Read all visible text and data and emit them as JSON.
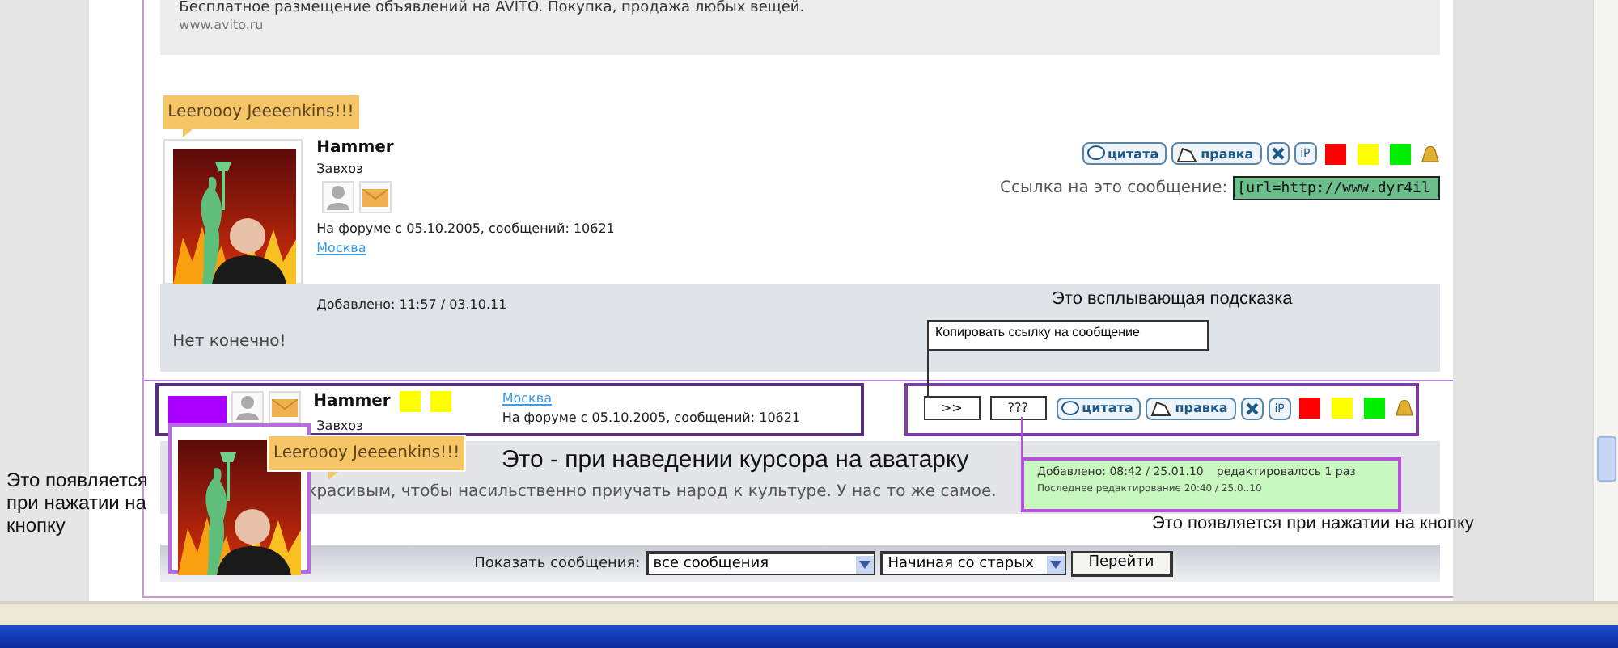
{
  "ad": {
    "text": "Бесплатное размещение объявлений на AVITO. Покупка, продажа любых вещей.",
    "url": "www.avito.ru"
  },
  "posts": [
    {
      "kind": "full",
      "status": "Leeroooy Jeeeenkins!!!",
      "name": "Hammer",
      "rank": "Завхоз",
      "since": "На форуме с 05.10.2005, сообщений: 10621",
      "city": "Москва",
      "link_label": "Ссылка на это сообщение:",
      "link_value": "[url=http://www.dyr4il",
      "added": "Добавлено: 11:57 / 03.10.11",
      "body": "Нет конечно!",
      "actions": [
        {
          "kind": "quote",
          "label": "цитата"
        },
        {
          "kind": "edit",
          "label": "правка"
        },
        {
          "kind": "delete"
        },
        {
          "kind": "ip",
          "label": "iP"
        },
        {
          "kind": "flag",
          "color": "#ff0000"
        },
        {
          "kind": "flag",
          "color": "#ffff00"
        },
        {
          "kind": "flag",
          "color": "#00ee00"
        },
        {
          "kind": "bell"
        }
      ]
    },
    {
      "kind": "compact",
      "name": "Hammer",
      "rank": "Завхоз",
      "since": "На форуме с 05.10.2005, сообщений: 10621",
      "city": "Москва",
      "badges": [
        {
          "color": "#ffff00"
        },
        {
          "color": "#ffff00"
        }
      ],
      "tools": [
        {
          "label": ">>"
        },
        {
          "label": "???"
        }
      ],
      "body": "красивым, чтобы насильственно приучать народ к культуре. У нас то же самое.",
      "actions": [
        {
          "kind": "quote",
          "label": "цитата"
        },
        {
          "kind": "edit",
          "label": "правка"
        },
        {
          "kind": "delete"
        },
        {
          "kind": "ip",
          "label": "iP"
        },
        {
          "kind": "flag",
          "color": "#ff0000"
        },
        {
          "kind": "flag",
          "color": "#ffff00"
        },
        {
          "kind": "flag",
          "color": "#00ee00"
        },
        {
          "kind": "bell"
        }
      ]
    }
  ],
  "footer": {
    "label": "Показать сообщения:",
    "filter": "все сообщения",
    "order": "Начиная со старых",
    "go": "Перейти"
  },
  "overlays": {
    "tooltip_note": "Это всплывающая подсказка",
    "tooltip": "Копировать ссылку на сообщение",
    "left_note": "Это появляется при нажатии на кнопку",
    "popup_status": "Leeroooy Jeeeenkins!!!",
    "hover_note": "Это - при наведении курсора на аватарку",
    "info_added": "Добавлено: 08:42 / 25.01.10",
    "info_edited": "редактировалось 1 раз",
    "info_last": "Последнее редактирование 20:40 / 25.0..10",
    "info_note": "Это появляется при нажатии на кнопку"
  }
}
